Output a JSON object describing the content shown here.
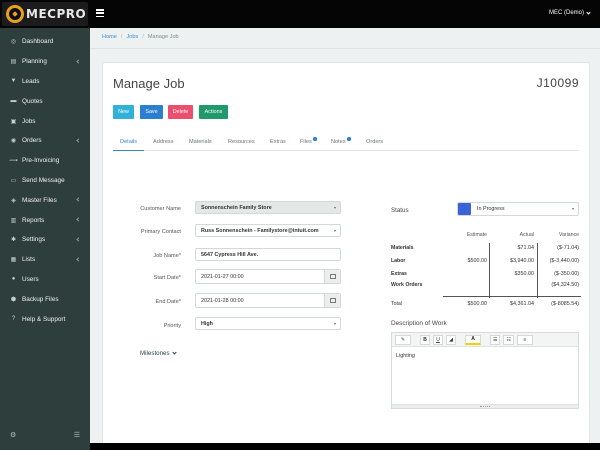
{
  "app": {
    "logo_text": "MECPRO",
    "user_label": "MEC (Demo)"
  },
  "sidebar": {
    "items": [
      {
        "label": "Dashboard",
        "icon": "dashboard-icon",
        "glyph": "◎",
        "expandable": false
      },
      {
        "label": "Planning",
        "icon": "planning-icon",
        "glyph": "▤",
        "expandable": true
      },
      {
        "label": "Leads",
        "icon": "filter-icon",
        "glyph": "▼",
        "expandable": false
      },
      {
        "label": "Quotes",
        "icon": "quotes-icon",
        "glyph": "▬",
        "expandable": false
      },
      {
        "label": "Jobs",
        "icon": "jobs-icon",
        "glyph": "▣",
        "expandable": false
      },
      {
        "label": "Orders",
        "icon": "orders-icon",
        "glyph": "◉",
        "expandable": true
      },
      {
        "label": "Pre-Invoicing",
        "icon": "pre-invoicing-icon",
        "glyph": "⟿",
        "expandable": false
      },
      {
        "label": "Send Message",
        "icon": "message-icon",
        "glyph": "▭",
        "expandable": false
      },
      {
        "label": "Master Files",
        "icon": "master-files-icon",
        "glyph": "◈",
        "expandable": true
      },
      {
        "label": "Reports",
        "icon": "reports-icon",
        "glyph": "▥",
        "expandable": true
      },
      {
        "label": "Settings",
        "icon": "settings-icon",
        "glyph": "✱",
        "expandable": true
      },
      {
        "label": "Lists",
        "icon": "lists-icon",
        "glyph": "▦",
        "expandable": true
      },
      {
        "label": "Users",
        "icon": "users-icon",
        "glyph": "●",
        "expandable": false
      },
      {
        "label": "Backup Files",
        "icon": "backup-icon",
        "glyph": "⬢",
        "expandable": false
      },
      {
        "label": "Help & Support",
        "icon": "help-icon",
        "glyph": "?",
        "expandable": false
      }
    ],
    "bottom_left_glyph": "⚙",
    "bottom_right_glyph": "☰"
  },
  "breadcrumb": {
    "home": "Home",
    "jobs": "Jobs",
    "current": "Manage Job",
    "sep": "/"
  },
  "page": {
    "title": "Manage Job",
    "job_number": "J10099"
  },
  "buttons": {
    "new": "New",
    "save": "Save",
    "delete": "Delete",
    "actions": "Actions"
  },
  "tabs": [
    "Details",
    "Address",
    "Materials",
    "Resources",
    "Extras",
    "Files",
    "Notes",
    "Orders"
  ],
  "form": {
    "customer_name": {
      "label": "Customer Name",
      "value": "Sonnenschein Family Store"
    },
    "primary_contact": {
      "label": "Primary Contact",
      "value": "Russ Sonnenschein - Familystore@intuit.com"
    },
    "job_name": {
      "label": "Job Name*",
      "value": "5647 Cypress Hill Ave."
    },
    "start_date": {
      "label": "Start Date*",
      "value": "2021-01-27 00:00"
    },
    "end_date": {
      "label": "End Date*",
      "value": "2021-01-28 00:00"
    },
    "priority": {
      "label": "Priority",
      "value": "High"
    },
    "milestones": "Milestones"
  },
  "status": {
    "label": "Status",
    "value": "In Progress",
    "color": "#3c62d8"
  },
  "costs": {
    "headers": {
      "estimate": "Estimate",
      "actual": "Actual",
      "variance": "Variance"
    },
    "rows": [
      {
        "label": "Materials",
        "estimate": "",
        "actual": "$71.04",
        "variance": "($-71.04)"
      },
      {
        "label": "Labor",
        "estimate": "$500.00",
        "actual": "$3,940.00",
        "variance": "($-3,440.00)"
      },
      {
        "label": "Extras",
        "estimate": "",
        "actual": "$350.00",
        "variance": "($-350.00)"
      },
      {
        "label": "Work Orders",
        "estimate": "",
        "actual": "",
        "variance": "($4,324.50)"
      }
    ],
    "total": {
      "label": "Total",
      "estimate": "$500.00",
      "actual": "$4,361.04",
      "variance": "($-8085.54)"
    }
  },
  "description": {
    "label": "Description of Work",
    "content": "Lighting",
    "toolbar": {
      "brush": "✎",
      "bold": "B",
      "underline": "U",
      "eraser": "◢",
      "color": "A",
      "ul": "☰",
      "ol": "☷",
      "align": "≡"
    }
  }
}
